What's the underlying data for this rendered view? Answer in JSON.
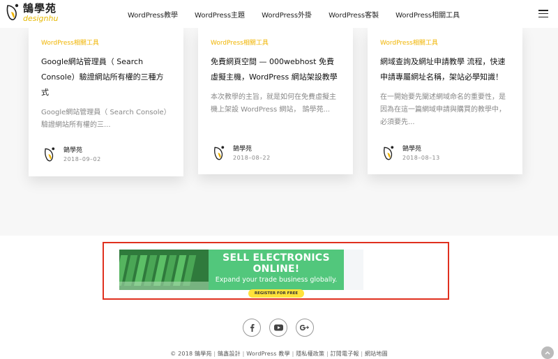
{
  "logo": {
    "cn": "鵠學苑",
    "en": "designhu"
  },
  "nav": [
    {
      "label": "WordPress教學"
    },
    {
      "label": "WordPress主題"
    },
    {
      "label": "WordPress外掛"
    },
    {
      "label": "WordPress客製"
    },
    {
      "label": "WordPress相關工具"
    }
  ],
  "cards": [
    {
      "category": "WordPress相關工具",
      "title": "Google網站管理員（ Search Console）驗證網站所有權的三種方式",
      "excerpt": "Google網站管理員（ Search Console）驗證網站所有權的三...",
      "author": "鵠學苑",
      "date": "2018–09–02"
    },
    {
      "category": "WordPress相關工具",
      "title": "免費網頁空間 — 000webhost 免費虛擬主機，WordPress 網站架設教學",
      "excerpt": "本次教學的主旨，就是如何在免費虛擬主機上架設 WordPress 網站， 鵠學苑...",
      "author": "鵠學苑",
      "date": "2018–08–22"
    },
    {
      "category": "WordPress相關工具",
      "title": "網域查詢及網址申請教學 流程，快速申請專屬網址名稱，架站必學知識！",
      "excerpt": "在一開始要先闡述網域命名的重要性，是因為在這一篇網域申請與購買的教學中，必須要先...",
      "author": "鵠學苑",
      "date": "2018–08–13"
    }
  ],
  "ad": {
    "headline": "SELL ELECTRONICS ONLINE!",
    "subline": "Expand your trade business globally.",
    "button": "REGISTER FOR FREE"
  },
  "social": [
    {
      "icon": "facebook-icon"
    },
    {
      "icon": "youtube-icon"
    },
    {
      "icon": "google-plus-icon"
    }
  ],
  "footer": {
    "copyright": "© 2018 鵠學苑",
    "links": [
      "鵠鑫設計",
      "WordPress 教學",
      "隱私權政策",
      "訂閱電子報",
      "網站地圖"
    ]
  },
  "colors": {
    "accent": "#f0b400",
    "ad_border": "#e0301e",
    "ad_green": "#52c77c",
    "ad_button": "#ffe23a"
  }
}
